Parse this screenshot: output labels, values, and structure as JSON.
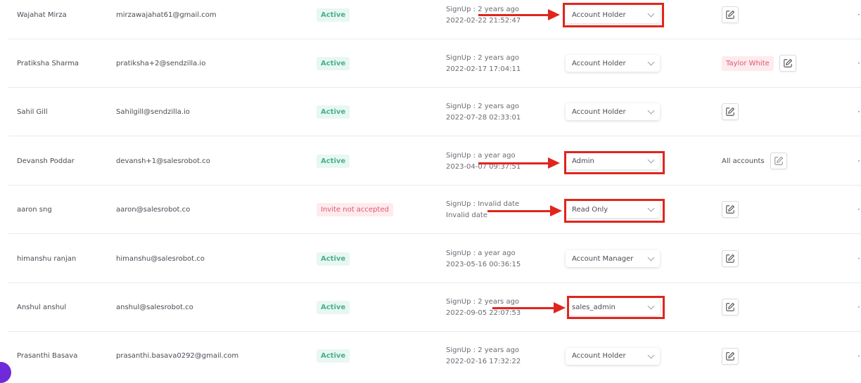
{
  "users": [
    {
      "name": "Wajahat Mirza",
      "email": "mirzawajahat61@gmail.com",
      "status": "Active",
      "signup": "SignUp : 2 years ago",
      "date": "2022-02-22 21:52:47",
      "role": "Account Holder",
      "assigned": null
    },
    {
      "name": "Pratiksha Sharma",
      "email": "pratiksha+2@sendzilla.io",
      "status": "Active",
      "signup": "SignUp : 2 years ago",
      "date": "2022-02-17 17:04:11",
      "role": "Account Holder",
      "assigned": "Taylor White"
    },
    {
      "name": "Sahil Gill",
      "email": "Sahilgill@sendzilla.io",
      "status": "Active",
      "signup": "SignUp : 2 years ago",
      "date": "2022-07-28 02:33:01",
      "role": "Account Holder",
      "assigned": null
    },
    {
      "name": "Devansh Poddar",
      "email": "devansh+1@salesrobot.co",
      "status": "Active",
      "signup": "SignUp : a year ago",
      "date": "2023-04-07 09:37:51",
      "role": "Admin",
      "assigned_text": "All accounts"
    },
    {
      "name": "aaron sng",
      "email": "aaron@salesrobot.co",
      "status": "Invite not accepted",
      "signup": "SignUp : Invalid date",
      "date": "Invalid date",
      "role": "Read Only",
      "assigned": null
    },
    {
      "name": "himanshu ranjan",
      "email": "himanshu@salesrobot.co",
      "status": "Active",
      "signup": "SignUp : a year ago",
      "date": "2023-05-16 00:36:15",
      "role": "Account Manager",
      "assigned": null
    },
    {
      "name": "Anshul anshul",
      "email": "anshul@salesrobot.co",
      "status": "Active",
      "signup": "SignUp : 2 years ago",
      "date": "2022-09-05 22:07:53",
      "role": "sales_admin",
      "assigned": null
    },
    {
      "name": "Prasanthi Basava",
      "email": "prasanthi.basava0292@gmail.com",
      "status": "Active",
      "signup": "SignUp : 2 years ago",
      "date": "2022-02-16 17:32:22",
      "role": "Account Holder",
      "assigned": null
    }
  ],
  "icons": {
    "edit": "edit-icon",
    "chevron": "chevron-down-icon",
    "more": "more-icon"
  },
  "colors": {
    "annotation": "#e0251c",
    "active": "#48b18a",
    "pending": "#e0566e"
  }
}
